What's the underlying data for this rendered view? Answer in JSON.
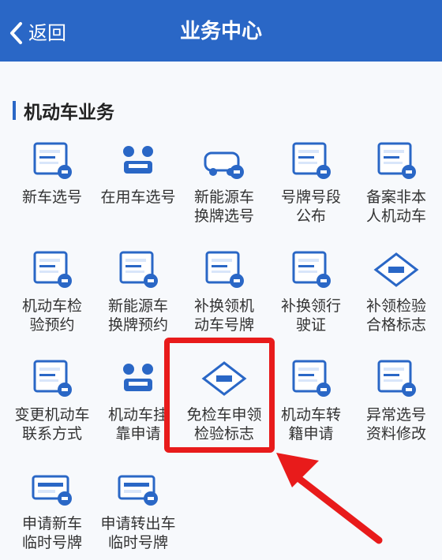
{
  "header": {
    "back_label": "返回",
    "title": "业务中心"
  },
  "section": {
    "title": "机动车业务"
  },
  "items": [
    {
      "label": "新车选号",
      "icon": "new-car-plate-icon"
    },
    {
      "label": "在用车选号",
      "icon": "in-use-car-plate-icon"
    },
    {
      "label": "新能源车\n换牌选号",
      "icon": "ev-plate-icon"
    },
    {
      "label": "号牌号段\n公布",
      "icon": "plate-range-icon"
    },
    {
      "label": "备案非本\n人机动车",
      "icon": "register-vehicle-icon"
    },
    {
      "label": "机动车检\n验预约",
      "icon": "inspection-appointment-icon"
    },
    {
      "label": "新能源车\n换牌预约",
      "icon": "ev-appointment-icon"
    },
    {
      "label": "补换领机\n动车号牌",
      "icon": "replace-plate-icon"
    },
    {
      "label": "补换领行\n驶证",
      "icon": "replace-license-icon"
    },
    {
      "label": "补领检验\n合格标志",
      "icon": "inspection-mark-icon"
    },
    {
      "label": "变更机动车\n联系方式",
      "icon": "change-contact-icon"
    },
    {
      "label": "机动车挂\n靠申请",
      "icon": "affiliation-icon"
    },
    {
      "label": "免检车申领\n检验标志",
      "icon": "exempt-mark-icon"
    },
    {
      "label": "机动车转\n籍申请",
      "icon": "transfer-icon"
    },
    {
      "label": "异常选号\n资料修改",
      "icon": "abnormal-plate-icon"
    },
    {
      "label": "申请新车\n临时号牌",
      "icon": "temp-plate-new-icon"
    },
    {
      "label": "申请转出车\n临时号牌",
      "icon": "temp-plate-out-icon"
    }
  ],
  "highlight_label": "免检车申领\n检验标志",
  "colors": {
    "accent": "#2a67c6",
    "highlight": "#e81b1b"
  }
}
